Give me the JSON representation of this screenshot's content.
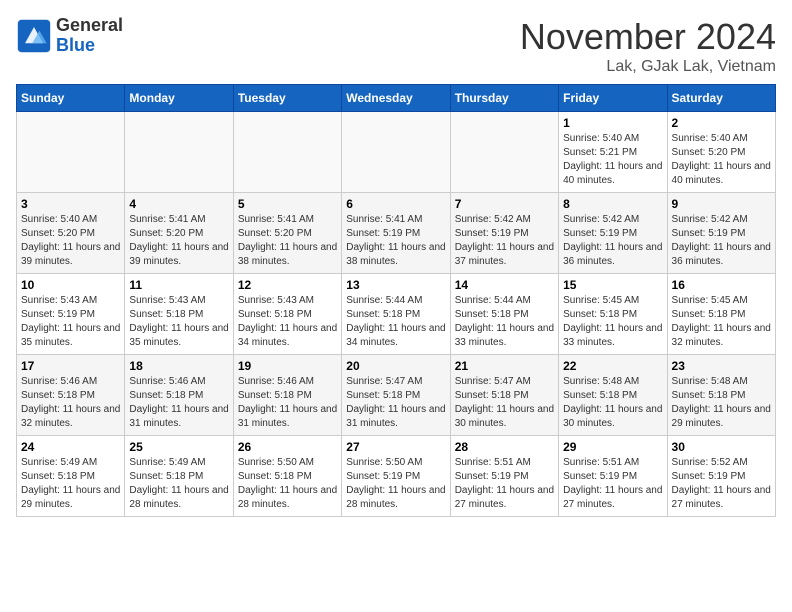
{
  "logo": {
    "general": "General",
    "blue": "Blue"
  },
  "title": "November 2024",
  "subtitle": "Lak, GJak Lak, Vietnam",
  "days_of_week": [
    "Sunday",
    "Monday",
    "Tuesday",
    "Wednesday",
    "Thursday",
    "Friday",
    "Saturday"
  ],
  "weeks": [
    [
      {
        "day": "",
        "detail": ""
      },
      {
        "day": "",
        "detail": ""
      },
      {
        "day": "",
        "detail": ""
      },
      {
        "day": "",
        "detail": ""
      },
      {
        "day": "",
        "detail": ""
      },
      {
        "day": "1",
        "detail": "Sunrise: 5:40 AM\nSunset: 5:21 PM\nDaylight: 11 hours and 40 minutes."
      },
      {
        "day": "2",
        "detail": "Sunrise: 5:40 AM\nSunset: 5:20 PM\nDaylight: 11 hours and 40 minutes."
      }
    ],
    [
      {
        "day": "3",
        "detail": "Sunrise: 5:40 AM\nSunset: 5:20 PM\nDaylight: 11 hours and 39 minutes."
      },
      {
        "day": "4",
        "detail": "Sunrise: 5:41 AM\nSunset: 5:20 PM\nDaylight: 11 hours and 39 minutes."
      },
      {
        "day": "5",
        "detail": "Sunrise: 5:41 AM\nSunset: 5:20 PM\nDaylight: 11 hours and 38 minutes."
      },
      {
        "day": "6",
        "detail": "Sunrise: 5:41 AM\nSunset: 5:19 PM\nDaylight: 11 hours and 38 minutes."
      },
      {
        "day": "7",
        "detail": "Sunrise: 5:42 AM\nSunset: 5:19 PM\nDaylight: 11 hours and 37 minutes."
      },
      {
        "day": "8",
        "detail": "Sunrise: 5:42 AM\nSunset: 5:19 PM\nDaylight: 11 hours and 36 minutes."
      },
      {
        "day": "9",
        "detail": "Sunrise: 5:42 AM\nSunset: 5:19 PM\nDaylight: 11 hours and 36 minutes."
      }
    ],
    [
      {
        "day": "10",
        "detail": "Sunrise: 5:43 AM\nSunset: 5:19 PM\nDaylight: 11 hours and 35 minutes."
      },
      {
        "day": "11",
        "detail": "Sunrise: 5:43 AM\nSunset: 5:18 PM\nDaylight: 11 hours and 35 minutes."
      },
      {
        "day": "12",
        "detail": "Sunrise: 5:43 AM\nSunset: 5:18 PM\nDaylight: 11 hours and 34 minutes."
      },
      {
        "day": "13",
        "detail": "Sunrise: 5:44 AM\nSunset: 5:18 PM\nDaylight: 11 hours and 34 minutes."
      },
      {
        "day": "14",
        "detail": "Sunrise: 5:44 AM\nSunset: 5:18 PM\nDaylight: 11 hours and 33 minutes."
      },
      {
        "day": "15",
        "detail": "Sunrise: 5:45 AM\nSunset: 5:18 PM\nDaylight: 11 hours and 33 minutes."
      },
      {
        "day": "16",
        "detail": "Sunrise: 5:45 AM\nSunset: 5:18 PM\nDaylight: 11 hours and 32 minutes."
      }
    ],
    [
      {
        "day": "17",
        "detail": "Sunrise: 5:46 AM\nSunset: 5:18 PM\nDaylight: 11 hours and 32 minutes."
      },
      {
        "day": "18",
        "detail": "Sunrise: 5:46 AM\nSunset: 5:18 PM\nDaylight: 11 hours and 31 minutes."
      },
      {
        "day": "19",
        "detail": "Sunrise: 5:46 AM\nSunset: 5:18 PM\nDaylight: 11 hours and 31 minutes."
      },
      {
        "day": "20",
        "detail": "Sunrise: 5:47 AM\nSunset: 5:18 PM\nDaylight: 11 hours and 31 minutes."
      },
      {
        "day": "21",
        "detail": "Sunrise: 5:47 AM\nSunset: 5:18 PM\nDaylight: 11 hours and 30 minutes."
      },
      {
        "day": "22",
        "detail": "Sunrise: 5:48 AM\nSunset: 5:18 PM\nDaylight: 11 hours and 30 minutes."
      },
      {
        "day": "23",
        "detail": "Sunrise: 5:48 AM\nSunset: 5:18 PM\nDaylight: 11 hours and 29 minutes."
      }
    ],
    [
      {
        "day": "24",
        "detail": "Sunrise: 5:49 AM\nSunset: 5:18 PM\nDaylight: 11 hours and 29 minutes."
      },
      {
        "day": "25",
        "detail": "Sunrise: 5:49 AM\nSunset: 5:18 PM\nDaylight: 11 hours and 28 minutes."
      },
      {
        "day": "26",
        "detail": "Sunrise: 5:50 AM\nSunset: 5:18 PM\nDaylight: 11 hours and 28 minutes."
      },
      {
        "day": "27",
        "detail": "Sunrise: 5:50 AM\nSunset: 5:19 PM\nDaylight: 11 hours and 28 minutes."
      },
      {
        "day": "28",
        "detail": "Sunrise: 5:51 AM\nSunset: 5:19 PM\nDaylight: 11 hours and 27 minutes."
      },
      {
        "day": "29",
        "detail": "Sunrise: 5:51 AM\nSunset: 5:19 PM\nDaylight: 11 hours and 27 minutes."
      },
      {
        "day": "30",
        "detail": "Sunrise: 5:52 AM\nSunset: 5:19 PM\nDaylight: 11 hours and 27 minutes."
      }
    ]
  ]
}
